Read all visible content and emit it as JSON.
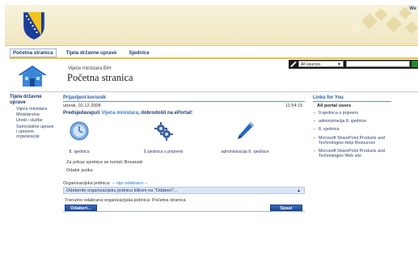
{
  "header": {
    "welcome": "We"
  },
  "topnav": {
    "items": [
      "Početna stranica",
      "Tijela državne uprave",
      "Sjednice"
    ]
  },
  "site": {
    "parent": "Vijeće ministara BiH",
    "title": "Početna stranica"
  },
  "search": {
    "scope": "All sources"
  },
  "leftnav": {
    "heading": "Tijela državne uprave",
    "items": [
      "Vijeće ministara",
      "Ministarstva",
      "Uredi i službe",
      "Samostalne uprave i upravne organizacije"
    ]
  },
  "main": {
    "title": "Prijavljeni korisnik",
    "date": "utorak, 02.12.2008",
    "time": "11:54:15",
    "greeting_prefix": "Predsjedavajući ",
    "greeting_org": "Vijeća ministara",
    "greeting_suffix": ", dobrodošli na ePortal!",
    "tiles": [
      "8. sjednica",
      "9.sjednica u pripremi",
      "administracija 8. sjednice"
    ],
    "language_line": "Za prikaz sjednice se koristi: Bosanski",
    "language_link": "Odabir jezika",
    "org_label": "Organizacijska jedinica: ",
    "org_value": "-- nije odabrano --",
    "org_bar": "Odaberite organizacijsku jedinicu klikom na \"Odaberi\"...",
    "org_current": "Trenutno odabrana organizacijska jedinica: Početna stranica",
    "btn_select": "Odaberi...",
    "btn_save": "Spasi"
  },
  "links": {
    "title": "Links for You",
    "group": "All portal users",
    "items": [
      "9.sjednica u pripremi",
      "administracija 8. sjednice",
      "8. sjednica",
      "Microsoft SharePoint Products and Technologies Help Resources",
      "Microsoft SharePoint Products and Technologies Web site"
    ]
  },
  "colors": {
    "accent": "#2b5aa8",
    "nav_rule": "#f0c040",
    "header_bg": "#f3ecd0"
  }
}
